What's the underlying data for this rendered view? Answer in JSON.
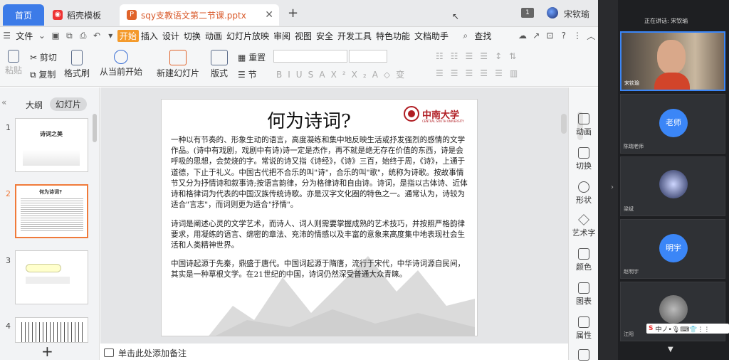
{
  "tabs": {
    "home": "首页",
    "template": "稻壳模板",
    "file": "sqy支教语文第二节课.pptx"
  },
  "badge": "1",
  "user_name": "宋钦瑜",
  "menu": {
    "file": "文件",
    "items": [
      "开始",
      "插入",
      "设计",
      "切换",
      "动画",
      "幻灯片放映",
      "审阅",
      "视图",
      "安全",
      "开发工具",
      "特色功能",
      "文档助手"
    ],
    "search": "查找"
  },
  "ribbon": {
    "paste": "粘贴",
    "cut": "剪切",
    "copy": "复制",
    "format_painter": "格式刷",
    "from_current": "从当前开始",
    "new_slide": "新建幻灯片",
    "layout": "版式",
    "reset": "重置",
    "section": "节",
    "text_fmt": [
      "B",
      "I",
      "U",
      "S",
      "A",
      "X²",
      "X₂",
      "A",
      "◇",
      "变"
    ]
  },
  "left_panel": {
    "outline_tab": "大纲",
    "slides_tab": "幻灯片",
    "slide_numbers": [
      "1",
      "2",
      "3",
      "4"
    ],
    "thumb1_title": "诗词之美",
    "thumb2_title": "何为诗词?"
  },
  "slide": {
    "title": "何为诗词?",
    "logo_text": "中南大学",
    "logo_sub": "CENTRAL SOUTH UNIVERSITY",
    "para1": "一种以有节奏的、形象生动的语言，高度凝练和集中地反映生活或抒发强烈的感情的文学作品。(诗中有戏剧，戏剧中有诗)诗一定是杰作，再不就是绝无存在价值的东西，诗是会呼吸的思想，会焚烧的字。常说的诗又指《诗经》，《诗》三百，始终于周，《诗》，上通于道德，下止于礼义。中国古代把不合乐的叫\"诗\"，合乐的叫\"歌\"，统称为诗歌。按故事情节又分为抒情诗和叙事诗;按语言韵律，分为格律诗和自由诗。诗词，是指以古体诗、近体诗和格律词为代表的中国汉族传统诗歌。亦是汉字文化圈的特色之一。通常认为，诗较为适合\"言志\"，而词则更为适合\"抒情\"。",
    "para2": "诗词是阐述心灵的文学艺术，而诗人、词人则需要掌握成熟的艺术技巧，并按照严格韵律要求，用凝练的语言、绵密的章法、充沛的情感以及丰富的意象来高度集中地表现社会生活和人类精神世界。",
    "para3": "中国诗起源于先秦，鼎盛于唐代。中国词起源于隋唐，流行于宋代，中华诗词源自民间，其实是一种草根文学。在21世纪的中国，诗词仍然深受普通大众青睐。"
  },
  "notes_placeholder": "单击此处添加备注",
  "right_tools": [
    "动画",
    "切换",
    "形状",
    "艺术字",
    "颜色",
    "图表",
    "属性"
  ],
  "meeting": {
    "speaking": "正在讲话: 宋钦瑜",
    "self_name": "宋钦瑜",
    "participants": [
      {
        "avatar": "老师",
        "name": "陈瑞老师"
      },
      {
        "avatar": "",
        "name": "梁斌"
      },
      {
        "avatar": "明宇",
        "name": "赵明宇"
      },
      {
        "avatar": "",
        "name": "江阳"
      }
    ],
    "ime": "中ノ•🎙⌨👕⋮⋮"
  }
}
